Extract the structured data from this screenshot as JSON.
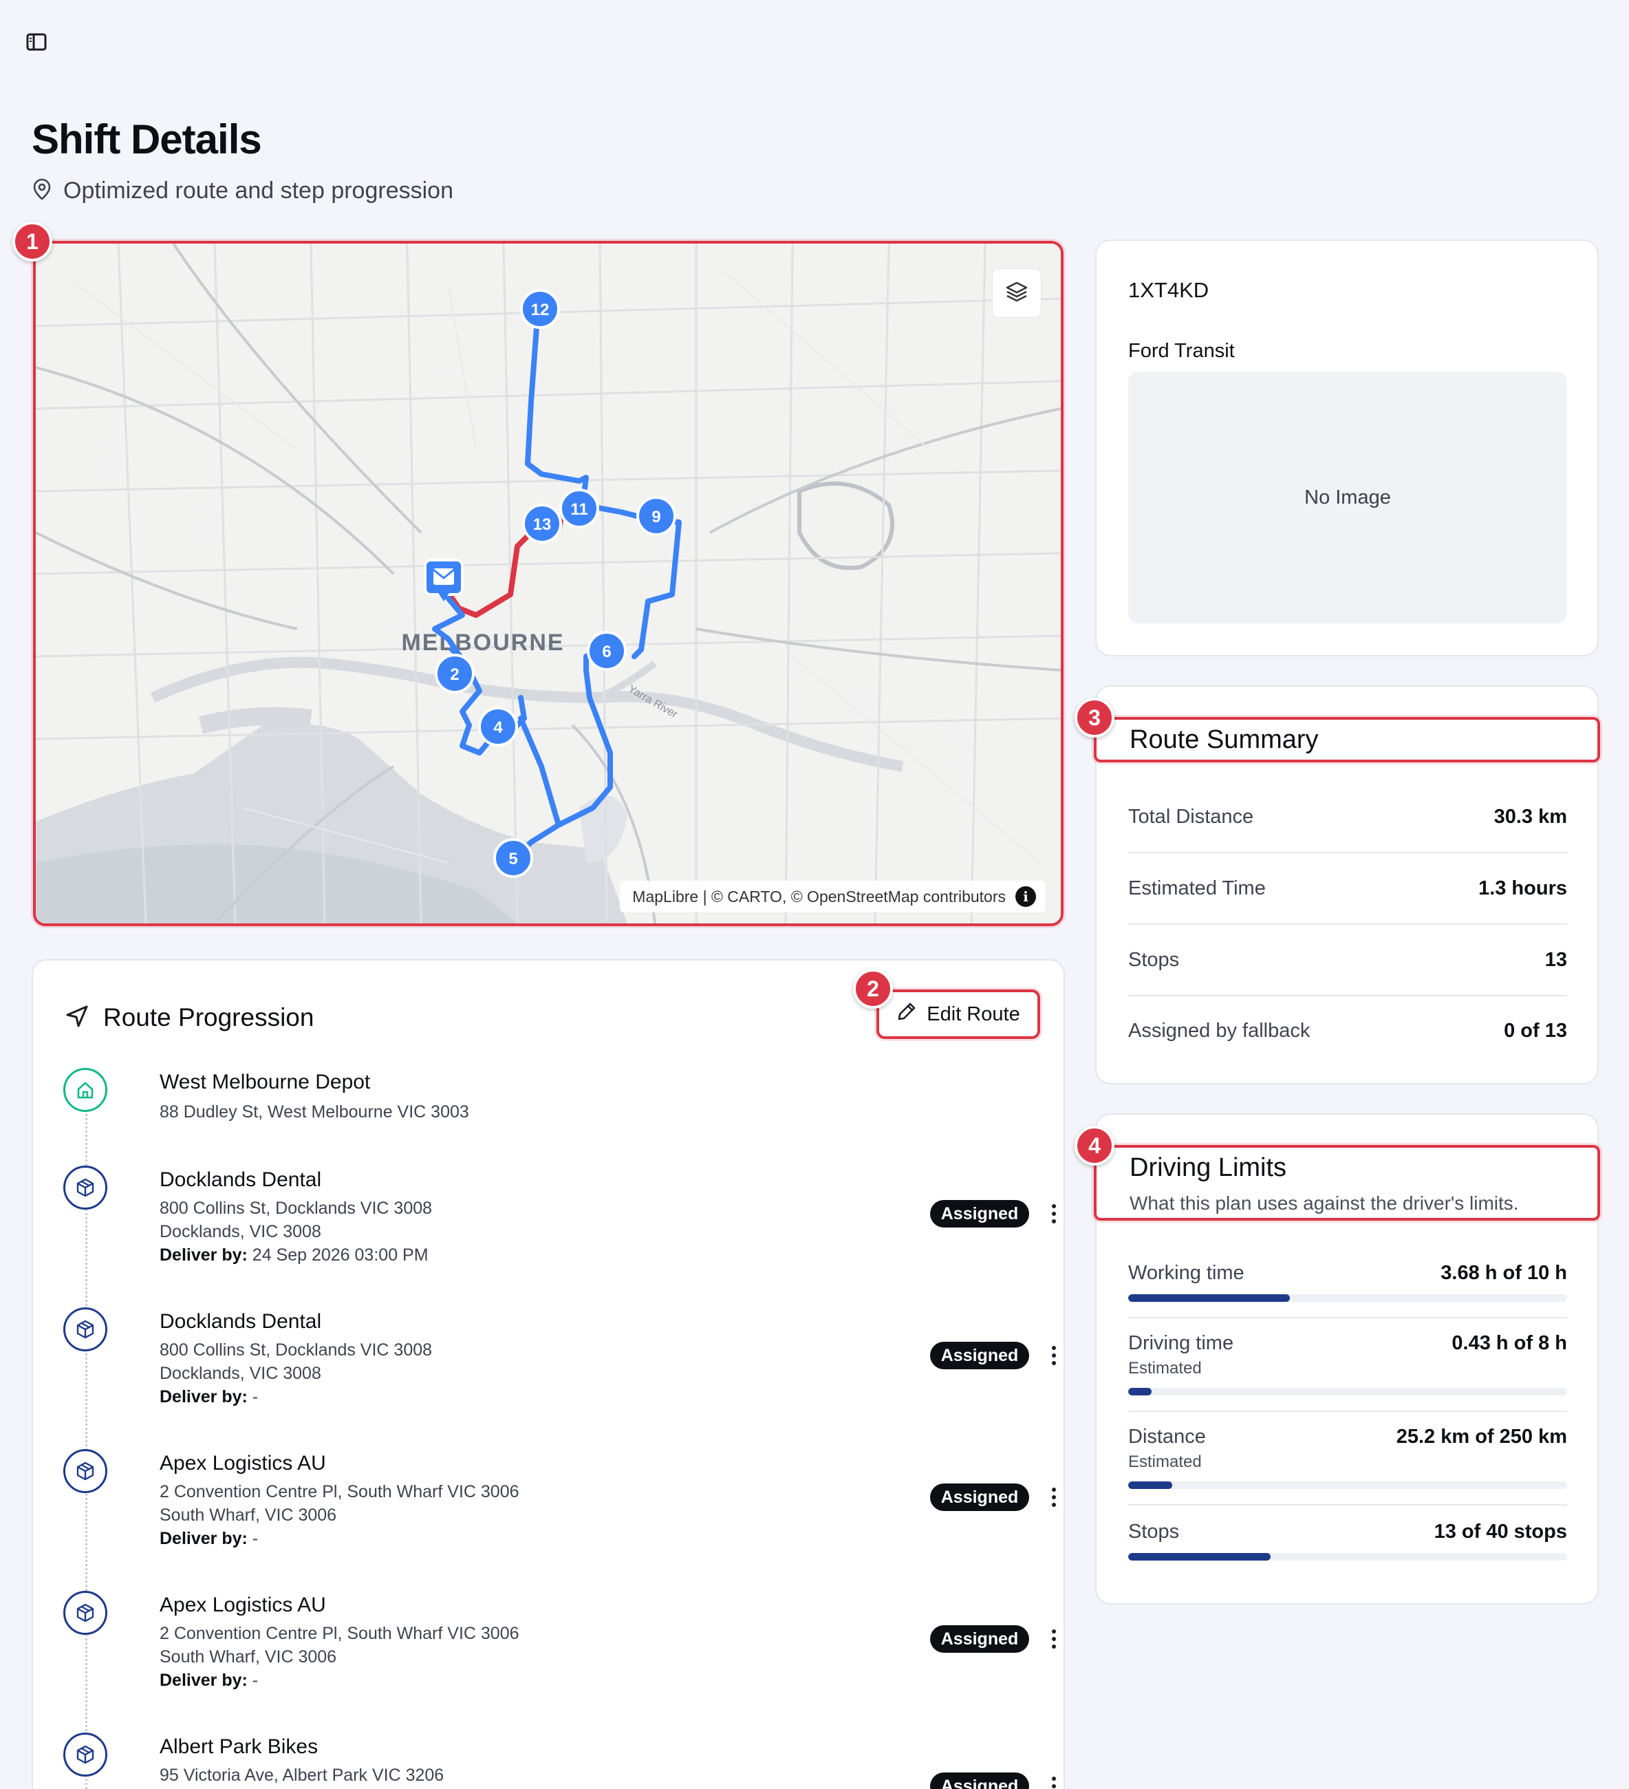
{
  "page": {
    "title": "Shift Details",
    "subtitle": "Optimized route and step progression"
  },
  "map": {
    "city_label": "MELBOURNE",
    "river_label": "Yarra River",
    "attribution": "MapLibre | © CARTO, © OpenStreetMap contributors",
    "attribution_info_glyph": "i",
    "markers": [
      "12",
      "11",
      "13",
      "9",
      "2",
      "6",
      "4",
      "5"
    ],
    "route_color": "#3b82f6",
    "alt_route_color": "#dc3545"
  },
  "callouts": [
    "1",
    "2",
    "3",
    "4"
  ],
  "vehicle": {
    "plate": "1XT4KD",
    "model": "Ford Transit",
    "image_placeholder": "No Image"
  },
  "route_summary": {
    "title": "Route Summary",
    "rows": [
      {
        "label": "Total Distance",
        "value": "30.3 km"
      },
      {
        "label": "Estimated Time",
        "value": "1.3 hours"
      },
      {
        "label": "Stops",
        "value": "13"
      },
      {
        "label": "Assigned by fallback",
        "value": "0 of 13"
      }
    ]
  },
  "driving_limits": {
    "title": "Driving Limits",
    "description": "What this plan uses against the driver's limits.",
    "items": [
      {
        "label": "Working time",
        "value": "3.68 h of 10 h",
        "note": "",
        "fraction": 0.368
      },
      {
        "label": "Driving time",
        "value": "0.43 h of 8 h",
        "note": "Estimated",
        "fraction": 0.054
      },
      {
        "label": "Distance",
        "value": "25.2 km of 250 km",
        "note": "Estimated",
        "fraction": 0.101
      },
      {
        "label": "Stops",
        "value": "13 of 40 stops",
        "note": "",
        "fraction": 0.325
      }
    ]
  },
  "route_progression": {
    "title": "Route Progression",
    "edit_label": "Edit Route",
    "stops": [
      {
        "name": "West Melbourne Depot",
        "address": "88 Dudley St, West Melbourne VIC 3003",
        "locality": "",
        "deliver_by_label": "",
        "deliver_by": "",
        "status": ""
      },
      {
        "name": "Docklands Dental",
        "address": "800 Collins St, Docklands VIC 3008",
        "locality": "Docklands, VIC 3008",
        "deliver_by_label": "Deliver by:",
        "deliver_by": " 24 Sep 2026 03:00 PM",
        "status": "Assigned"
      },
      {
        "name": "Docklands Dental",
        "address": "800 Collins St, Docklands VIC 3008",
        "locality": "Docklands, VIC 3008",
        "deliver_by_label": "Deliver by:",
        "deliver_by": " -",
        "status": "Assigned"
      },
      {
        "name": "Apex Logistics AU",
        "address": "2 Convention Centre Pl, South Wharf VIC 3006",
        "locality": "South Wharf, VIC 3006",
        "deliver_by_label": "Deliver by:",
        "deliver_by": " -",
        "status": "Assigned"
      },
      {
        "name": "Apex Logistics AU",
        "address": "2 Convention Centre Pl, South Wharf VIC 3006",
        "locality": "South Wharf, VIC 3006",
        "deliver_by_label": "Deliver by:",
        "deliver_by": " -",
        "status": "Assigned"
      },
      {
        "name": "Albert Park Bikes",
        "address": "95 Victoria Ave, Albert Park VIC 3206",
        "locality": "",
        "deliver_by_label": "",
        "deliver_by": "",
        "status": "Assigned"
      }
    ]
  }
}
